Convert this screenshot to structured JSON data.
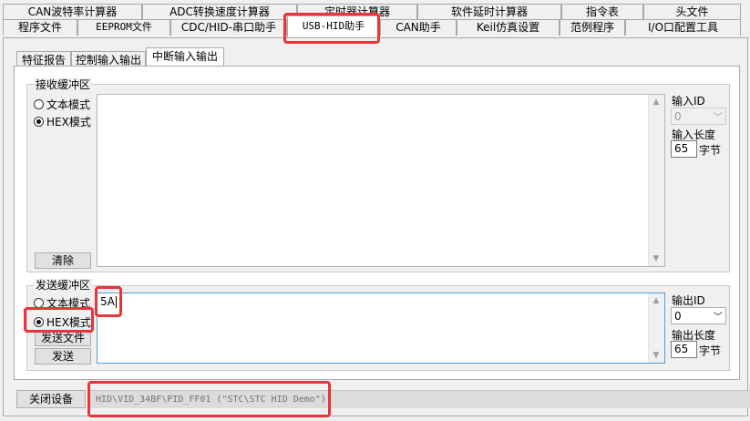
{
  "main_tabs": {
    "row1": [
      "CAN波特率计算器",
      "ADC转换速度计算器",
      "定时器计算器",
      "软件延时计算器",
      "指令表",
      "头文件"
    ],
    "row2": [
      "程序文件",
      "EEPROM文件",
      "CDC/HID-串口助手",
      "USB-HID助手",
      "CAN助手",
      "Keil仿真设置",
      "范例程序",
      "I/O口配置工具"
    ],
    "active": "USB-HID助手"
  },
  "sub_tabs": {
    "items": [
      "特征报告",
      "控制输入输出",
      "中断输入输出"
    ],
    "active": "中断输入输出"
  },
  "receive": {
    "group_title": "接收缓冲区",
    "mode_text": "文本模式",
    "mode_hex": "HEX模式",
    "selected_mode": "HEX模式",
    "clear_button": "清除",
    "buffer_content": "",
    "input_id_label": "输入ID",
    "input_id_value": "0",
    "input_len_label": "输入长度",
    "input_len_value": "65",
    "unit": "字节"
  },
  "send": {
    "group_title": "发送缓冲区",
    "mode_text": "文本模式",
    "mode_hex": "HEX模式",
    "selected_mode": "HEX模式",
    "send_file_button": "发送文件",
    "send_button": "发送",
    "buffer_content": "5A",
    "output_id_label": "输出ID",
    "output_id_value": "0",
    "output_len_label": "输出长度",
    "output_len_value": "65",
    "unit": "字节"
  },
  "footer": {
    "close_device_button": "关闭设备",
    "device_path": "HID\\VID_34BF\\PID_FF01 (\"STC\\STC HID Demo\")"
  },
  "colors": {
    "highlight_box": "#e8343a",
    "window_bg": "#f0f0f0"
  }
}
